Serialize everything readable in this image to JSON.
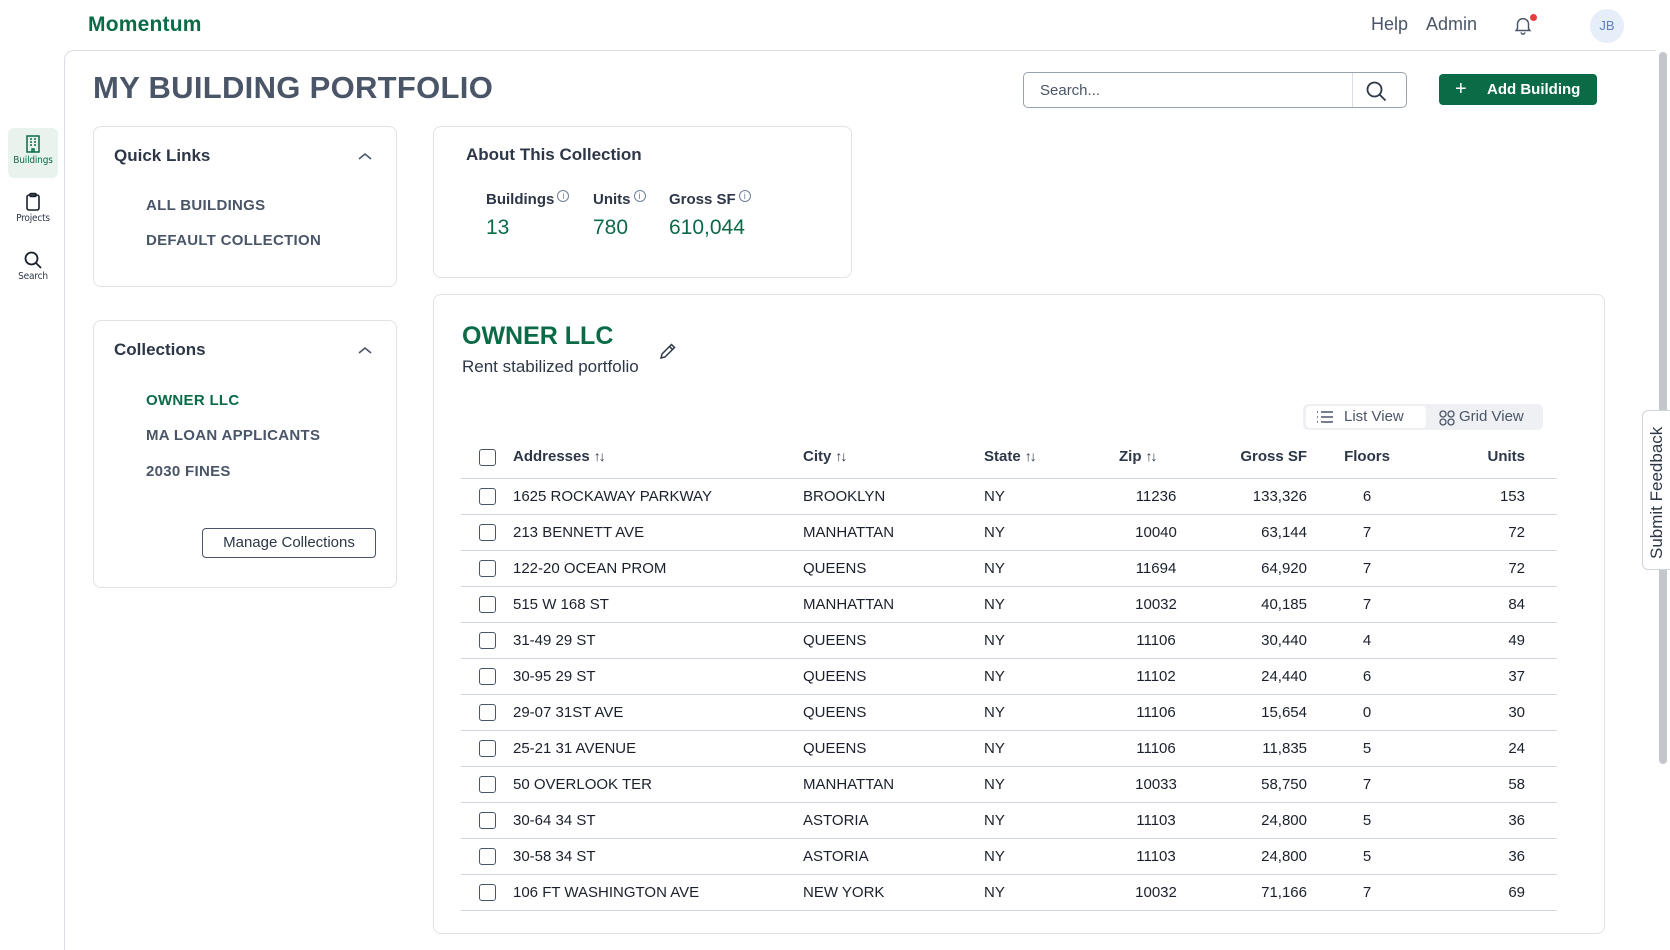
{
  "app": {
    "brand": "Momentum"
  },
  "topnav": {
    "help": "Help",
    "admin": "Admin",
    "avatar_initials": "JB",
    "notification_dot_color": "#e53e3e"
  },
  "rail": [
    {
      "label": "Buildings",
      "icon": "building-icon",
      "active": true
    },
    {
      "label": "Projects",
      "icon": "clipboard-icon",
      "active": false
    },
    {
      "label": "Search",
      "icon": "search-icon",
      "active": false
    }
  ],
  "page": {
    "title": "MY BUILDING PORTFOLIO"
  },
  "search": {
    "placeholder": "Search...",
    "value": ""
  },
  "add_button": {
    "label": "Add Building",
    "icon": "plus-icon"
  },
  "quick_links": {
    "title": "Quick Links",
    "items": [
      {
        "label": "ALL BUILDINGS"
      },
      {
        "label": "DEFAULT COLLECTION"
      }
    ]
  },
  "collections": {
    "title": "Collections",
    "items": [
      {
        "label": "OWNER LLC",
        "active": true
      },
      {
        "label": "MA LOAN APPLICANTS",
        "active": false
      },
      {
        "label": "2030 FINES",
        "active": false
      }
    ],
    "manage_label": "Manage Collections"
  },
  "about": {
    "title": "About This Collection",
    "stats": [
      {
        "label": "Buildings",
        "value": "13"
      },
      {
        "label": "Units",
        "value": "780"
      },
      {
        "label": "Gross SF",
        "value": "610,044"
      }
    ]
  },
  "collection_detail": {
    "name": "OWNER LLC",
    "subtitle": "Rent stabilized portfolio",
    "views": [
      {
        "label": "List View",
        "active": true
      },
      {
        "label": "Grid View",
        "active": false
      }
    ]
  },
  "table": {
    "columns": [
      {
        "label": "Addresses",
        "sortable": true
      },
      {
        "label": "City",
        "sortable": true
      },
      {
        "label": "State",
        "sortable": true
      },
      {
        "label": "Zip",
        "sortable": true
      },
      {
        "label": "Gross SF",
        "sortable": false
      },
      {
        "label": "Floors",
        "sortable": false
      },
      {
        "label": "Units",
        "sortable": false
      }
    ],
    "sort_glyph": "↑↓",
    "rows": [
      {
        "address": "1625 ROCKAWAY PARKWAY",
        "city": "BROOKLYN",
        "state": "NY",
        "zip": "11236",
        "gross_sf": "133,326",
        "floors": "6",
        "units": "153"
      },
      {
        "address": "213 BENNETT AVE",
        "city": "MANHATTAN",
        "state": "NY",
        "zip": "10040",
        "gross_sf": "63,144",
        "floors": "7",
        "units": "72"
      },
      {
        "address": "122-20 OCEAN PROM",
        "city": "QUEENS",
        "state": "NY",
        "zip": "11694",
        "gross_sf": "64,920",
        "floors": "7",
        "units": "72"
      },
      {
        "address": "515 W 168 ST",
        "city": "MANHATTAN",
        "state": "NY",
        "zip": "10032",
        "gross_sf": "40,185",
        "floors": "7",
        "units": "84"
      },
      {
        "address": "31-49 29 ST",
        "city": "QUEENS",
        "state": "NY",
        "zip": "11106",
        "gross_sf": "30,440",
        "floors": "4",
        "units": "49"
      },
      {
        "address": "30-95 29 ST",
        "city": "QUEENS",
        "state": "NY",
        "zip": "11102",
        "gross_sf": "24,440",
        "floors": "6",
        "units": "37"
      },
      {
        "address": "29-07 31ST AVE",
        "city": "QUEENS",
        "state": "NY",
        "zip": "11106",
        "gross_sf": "15,654",
        "floors": "0",
        "units": "30"
      },
      {
        "address": "25-21 31 AVENUE",
        "city": "QUEENS",
        "state": "NY",
        "zip": "11106",
        "gross_sf": "11,835",
        "floors": "5",
        "units": "24"
      },
      {
        "address": "50 OVERLOOK TER",
        "city": "MANHATTAN",
        "state": "NY",
        "zip": "10033",
        "gross_sf": "58,750",
        "floors": "7",
        "units": "58"
      },
      {
        "address": "30-64 34 ST",
        "city": "ASTORIA",
        "state": "NY",
        "zip": "11103",
        "gross_sf": "24,800",
        "floors": "5",
        "units": "36"
      },
      {
        "address": "30-58 34 ST",
        "city": "ASTORIA",
        "state": "NY",
        "zip": "11103",
        "gross_sf": "24,800",
        "floors": "5",
        "units": "36"
      },
      {
        "address": "106 FT WASHINGTON AVE",
        "city": "NEW YORK",
        "state": "NY",
        "zip": "10032",
        "gross_sf": "71,166",
        "floors": "7",
        "units": "69"
      }
    ]
  },
  "feedback": {
    "label": "Submit Feedback"
  },
  "colors": {
    "brand": "#0b6b47",
    "text": "#2d3748",
    "border": "#dfe3e8",
    "alert": "#e53e3e"
  }
}
